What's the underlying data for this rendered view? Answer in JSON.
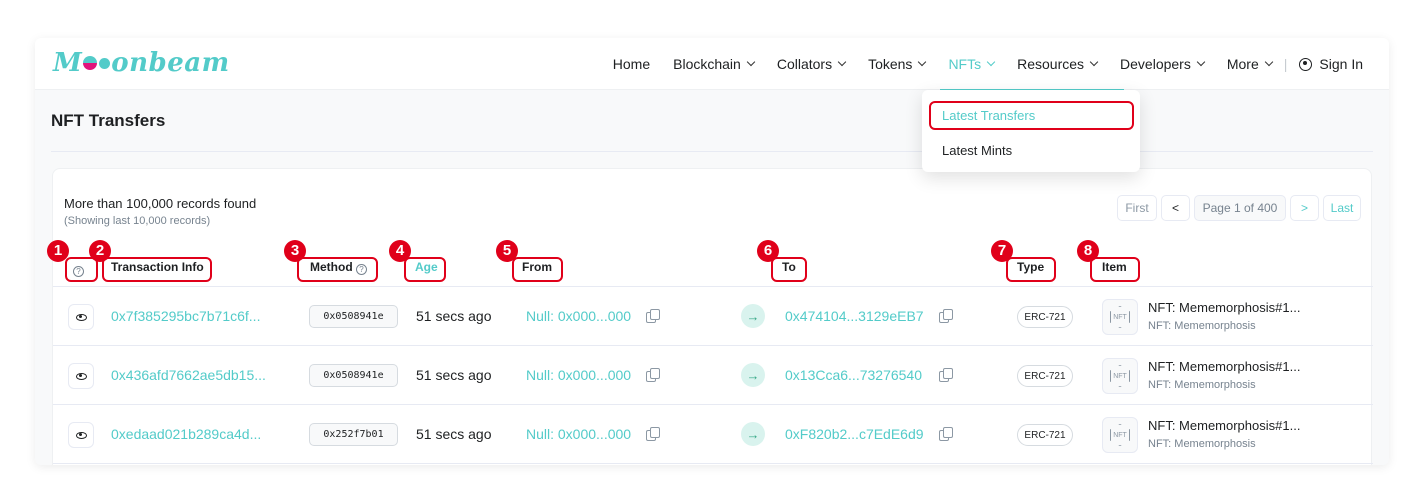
{
  "header": {
    "logo_before": "M",
    "logo_after": "onbeam",
    "nav": [
      {
        "label": "Home",
        "dropdown": false,
        "active": false
      },
      {
        "label": "Blockchain",
        "dropdown": true,
        "active": false
      },
      {
        "label": "Collators",
        "dropdown": true,
        "active": false
      },
      {
        "label": "Tokens",
        "dropdown": true,
        "active": false
      },
      {
        "label": "NFTs",
        "dropdown": true,
        "active": true
      },
      {
        "label": "Resources",
        "dropdown": true,
        "active": false
      },
      {
        "label": "Developers",
        "dropdown": true,
        "active": false
      },
      {
        "label": "More",
        "dropdown": true,
        "active": false
      }
    ],
    "separator": "|",
    "sign_in": "Sign In"
  },
  "dropdown": {
    "items": [
      "Latest Transfers",
      "Latest Mints"
    ]
  },
  "page": {
    "title": "NFT Transfers",
    "records_found": "More than 100,000 records found",
    "records_showing": "(Showing last 10,000 records)"
  },
  "pager": {
    "first": "First",
    "prev": "<",
    "page": "Page 1 of 400",
    "next": ">",
    "last": "Last"
  },
  "table": {
    "headers": {
      "info": "?",
      "transaction_info": "Transaction Info",
      "method": "Method",
      "age": "Age",
      "from": "From",
      "to": "To",
      "type": "Type",
      "item": "Item"
    },
    "rows": [
      {
        "tx": "0x7f385295bc7b71c6f...",
        "method": "0x0508941e",
        "age": "51 secs ago",
        "from": "Null: 0x000...000",
        "to": "0x474104...3129eEB7",
        "type": "ERC-721",
        "item_name": "NFT: Mememorphosis#1...",
        "item_collection": "NFT: Mememorphosis"
      },
      {
        "tx": "0x436afd7662ae5db15...",
        "method": "0x0508941e",
        "age": "51 secs ago",
        "from": "Null: 0x000...000",
        "to": "0x13Cca6...73276540",
        "type": "ERC-721",
        "item_name": "NFT: Mememorphosis#1...",
        "item_collection": "NFT: Mememorphosis"
      },
      {
        "tx": "0xedaad021b289ca4d...",
        "method": "0x252f7b01",
        "age": "51 secs ago",
        "from": "Null: 0x000...000",
        "to": "0xF820b2...c7EdE6d9",
        "type": "ERC-721",
        "item_name": "NFT: Mememorphosis#1...",
        "item_collection": "NFT: Mememorphosis"
      }
    ]
  },
  "annotations": [
    "1",
    "2",
    "3",
    "4",
    "5",
    "6",
    "7",
    "8"
  ],
  "colors": {
    "accent": "#53cbc9",
    "highlight": "#e0001a"
  }
}
